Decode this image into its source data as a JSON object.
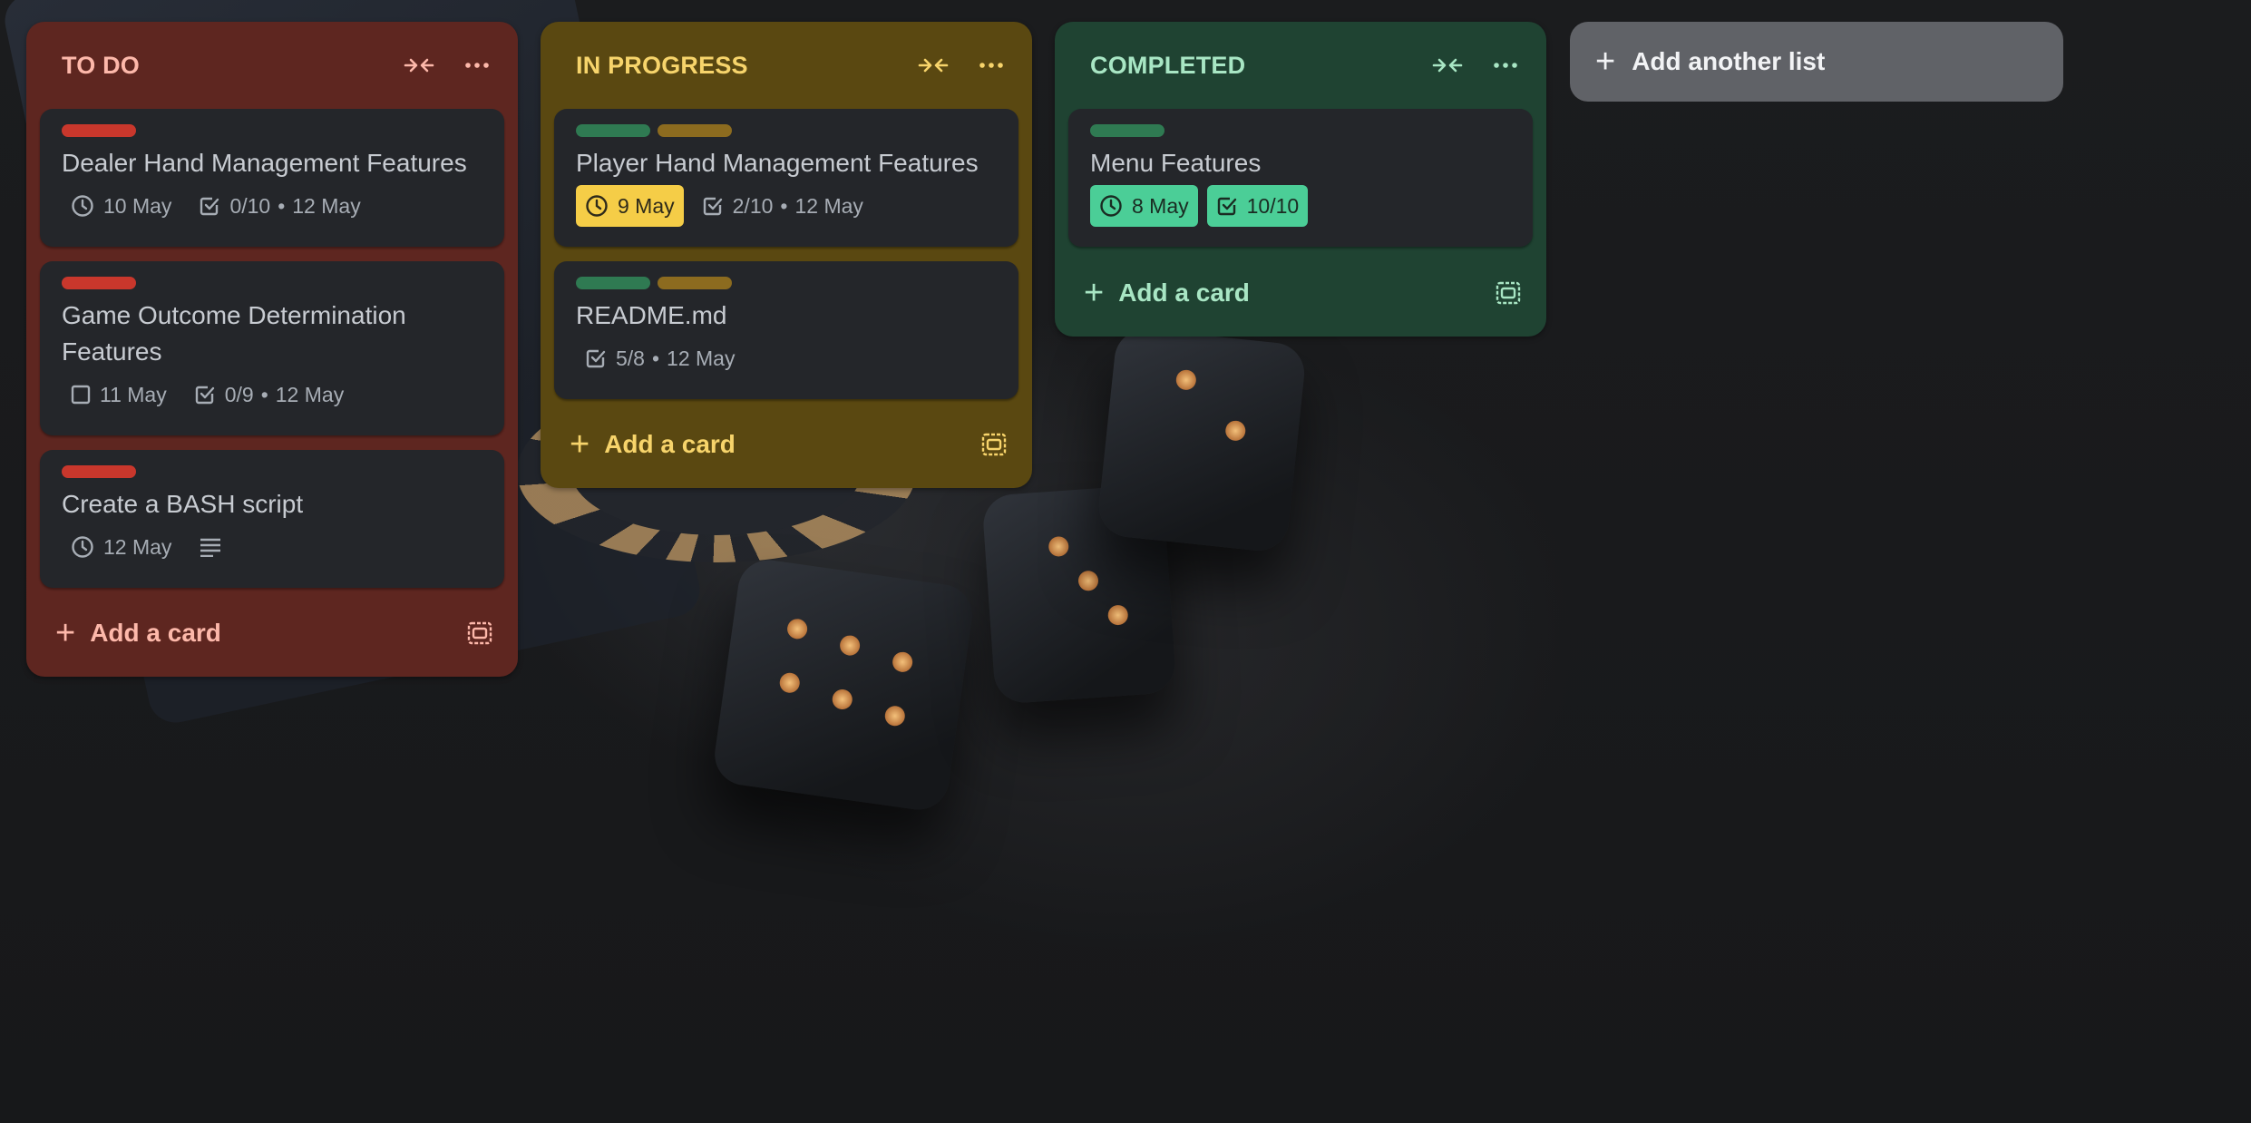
{
  "lists": [
    {
      "title": "TO DO",
      "add_card_label": "Add a card",
      "cards": [
        {
          "title": "Dealer Hand Management Features",
          "labels": [
            "red"
          ],
          "start_date": "10 May",
          "checklist": "0/10",
          "due_date": "12 May"
        },
        {
          "title": "Game Outcome Determination Features",
          "labels": [
            "red"
          ],
          "start_date": "11 May",
          "checklist": "0/9",
          "due_date": "12 May"
        },
        {
          "title": "Create a BASH script",
          "labels": [
            "red"
          ],
          "due_date": "12 May",
          "has_description": true
        }
      ]
    },
    {
      "title": "IN PROGRESS",
      "add_card_label": "Add a card",
      "cards": [
        {
          "title": "Player Hand Management Features",
          "labels": [
            "green",
            "gold"
          ],
          "due_date_badge": "9 May",
          "checklist": "2/10",
          "due_date": "12 May"
        },
        {
          "title": "README.md",
          "labels": [
            "green",
            "gold"
          ],
          "checklist": "5/8",
          "due_date": "12 May"
        }
      ]
    },
    {
      "title": "COMPLETED",
      "add_card_label": "Add a card",
      "cards": [
        {
          "title": "Menu Features",
          "labels": [
            "green"
          ],
          "due_date_badge": "8 May",
          "checklist_badge": "10/10"
        }
      ]
    }
  ],
  "add_list_label": "Add another list",
  "colors": {
    "todo_bg": "#5e2620",
    "inprogress_bg": "#5a4811",
    "completed_bg": "#1f4332",
    "label_red": "#c9372c",
    "label_green": "#2f7a52",
    "label_gold": "#8c6b1f",
    "badge_yellow": "#f5cd47",
    "badge_green": "#4bce97"
  },
  "icons": {
    "collapse": "collapse-arrows-icon",
    "more": "more-dots-icon",
    "clock": "clock-icon",
    "checklist": "checkbox-icon",
    "description": "description-lines-icon",
    "template": "card-template-icon",
    "plus": "plus-icon"
  },
  "dot": "•"
}
